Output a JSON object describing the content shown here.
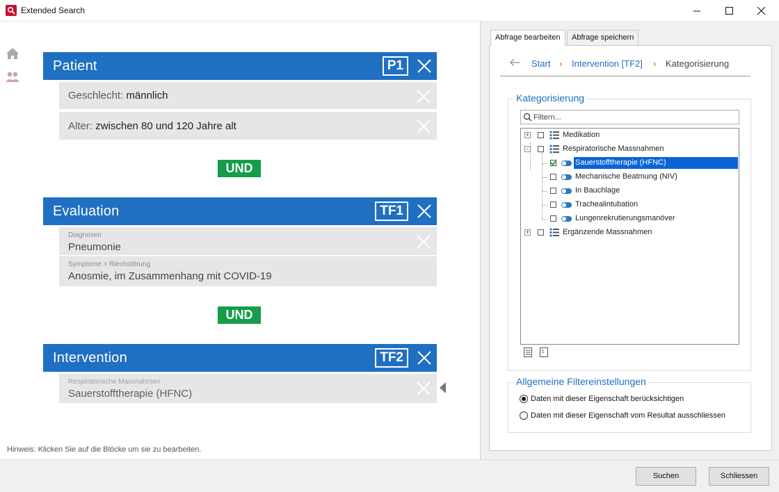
{
  "window": {
    "title": "Extended Search"
  },
  "blocks": [
    {
      "title": "Patient",
      "badge": "P1",
      "criteria": [
        {
          "label": "Geschlecht:",
          "value": "männlich"
        },
        {
          "label": "Alter:",
          "value": "zwischen 80 und 120 Jahre alt"
        }
      ]
    },
    {
      "title": "Evaluation",
      "badge": "TF1",
      "criteria": [
        {
          "category": "Diagnosen",
          "value": "Pneumonie"
        },
        {
          "category": "Symptome > Riechstörung",
          "value": "Anosmie, im Zusammenhang mit COVID-19"
        }
      ]
    },
    {
      "title": "Intervention",
      "badge": "TF2",
      "criteria": [
        {
          "category": "Respiratorische Massnahmen",
          "value": "Sauerstofftherapie (HFNC)"
        }
      ]
    }
  ],
  "operators": [
    "UND",
    "UND"
  ],
  "hint": "Hinweis: Klicken Sie auf die Blöcke um sie zu bearbeiten.",
  "tabs": [
    "Abfrage bearbeiten",
    "Abfrage speichern"
  ],
  "breadcrumb": [
    "Start",
    "Intervention [TF2]",
    "Kategorisierung"
  ],
  "categorization": {
    "title": "Kategorisierung",
    "filter_placeholder": "Filtern...",
    "tree": [
      {
        "label": "Medikation",
        "expander": "+"
      },
      {
        "label": "Respiratorische Massnahmen",
        "expander": "-"
      },
      {
        "label": "Sauerstofftherapie (HFNC)",
        "checked": true,
        "selected": true
      },
      {
        "label": "Mechanische Beatmung (NIV)"
      },
      {
        "label": "In Bauchlage"
      },
      {
        "label": "Trachealintubation"
      },
      {
        "label": "Lungenrekrutierungsmanöver"
      },
      {
        "label": "Ergänzende Massnahmen",
        "expander": "+"
      }
    ]
  },
  "filter_settings": {
    "title": "Allgemeine Filtereinstellungen",
    "options": [
      "Daten mit dieser Eigenschaft berücksichtigen",
      "Daten mit dieser Eigenschaft vom Resultat ausschliessen"
    ],
    "selected_index": 0
  },
  "footer": {
    "search_label": "Suchen",
    "close_label": "Schliessen"
  },
  "colors": {
    "accent": "#1f6fc3",
    "operator": "#179c4a",
    "selection": "#0a64d6"
  }
}
